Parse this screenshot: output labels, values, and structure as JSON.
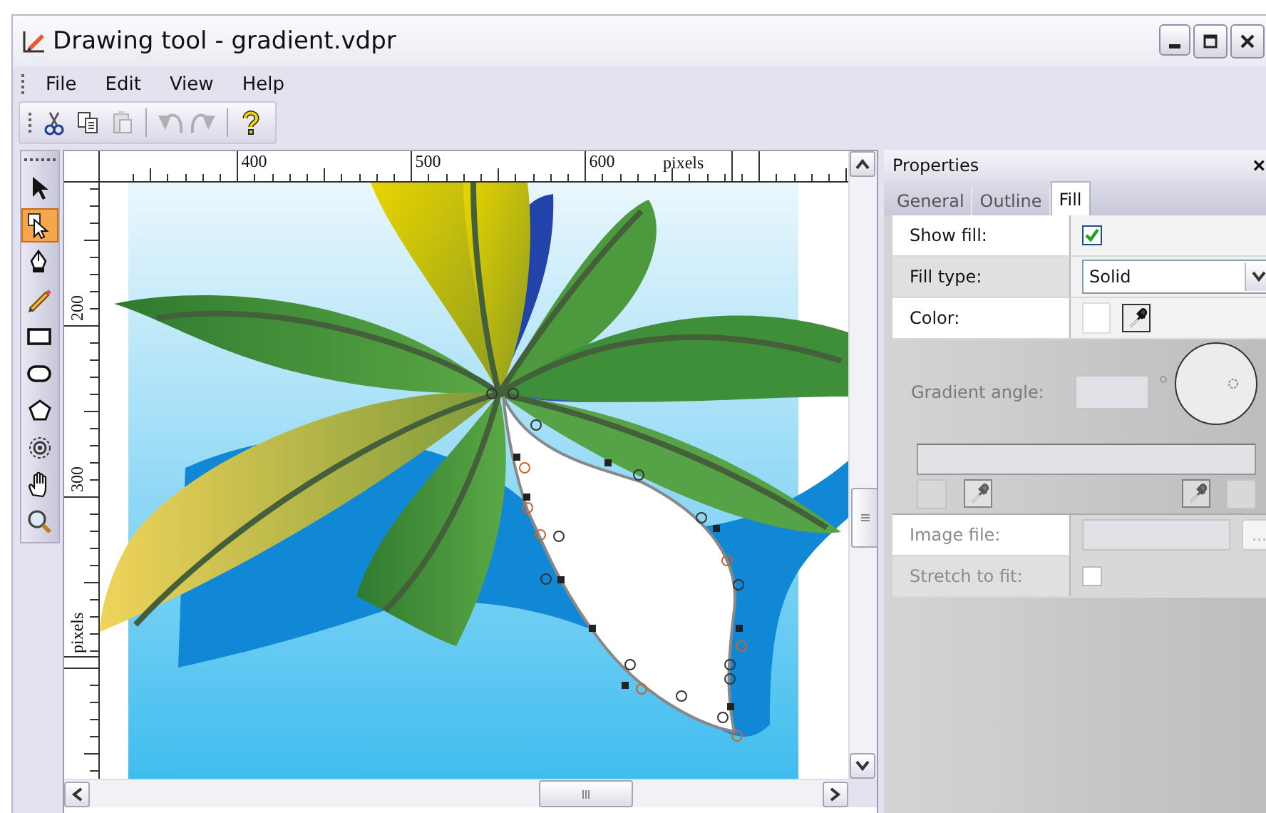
{
  "window": {
    "title": "Drawing tool - gradient.vdpr"
  },
  "menu": [
    {
      "label": "File"
    },
    {
      "label": "Edit"
    },
    {
      "label": "View"
    },
    {
      "label": "Help"
    }
  ],
  "toolbar": [
    {
      "kind": "cut",
      "disabled": false
    },
    {
      "kind": "copy",
      "disabled": false
    },
    {
      "kind": "paste",
      "disabled": true
    },
    {
      "kind": "sep"
    },
    {
      "kind": "undo",
      "disabled": true
    },
    {
      "kind": "redo",
      "disabled": true
    },
    {
      "kind": "sep"
    },
    {
      "kind": "help",
      "disabled": false
    }
  ],
  "tools": [
    {
      "kind": "pointer",
      "selected": false
    },
    {
      "kind": "node",
      "selected": true
    },
    {
      "kind": "pen",
      "selected": false
    },
    {
      "kind": "pencil",
      "selected": false
    },
    {
      "kind": "rect",
      "selected": false
    },
    {
      "kind": "ellipse",
      "selected": false
    },
    {
      "kind": "polygon",
      "selected": false
    },
    {
      "kind": "spiral",
      "selected": false
    },
    {
      "kind": "hand",
      "selected": false
    },
    {
      "kind": "zoom",
      "selected": false
    }
  ],
  "ruler_top": {
    "labels": [
      "400",
      "500",
      "600"
    ],
    "unit": "pixels"
  },
  "ruler_left": {
    "labels": [
      "200",
      "300"
    ],
    "unit": "pixels"
  },
  "properties": {
    "title": "Properties",
    "close": "×",
    "tabs": [
      {
        "label": "General",
        "selected": false
      },
      {
        "label": "Outline",
        "selected": false
      },
      {
        "label": "Fill",
        "selected": true
      }
    ],
    "rows": [
      {
        "kind": "checkbox",
        "label": "Show fill:",
        "checked": true
      },
      {
        "kind": "select",
        "label": "Fill type:",
        "value": "Solid"
      },
      {
        "kind": "color",
        "label": "Color:"
      }
    ],
    "gradient": {
      "disabled": true,
      "label": "Gradient angle:"
    },
    "image_rows": [
      {
        "kind": "file",
        "label": "Image file:",
        "button": "...",
        "disabled": true
      },
      {
        "kind": "checkbox",
        "label": "Stretch to fit:",
        "checked": false,
        "disabled": true
      }
    ]
  }
}
